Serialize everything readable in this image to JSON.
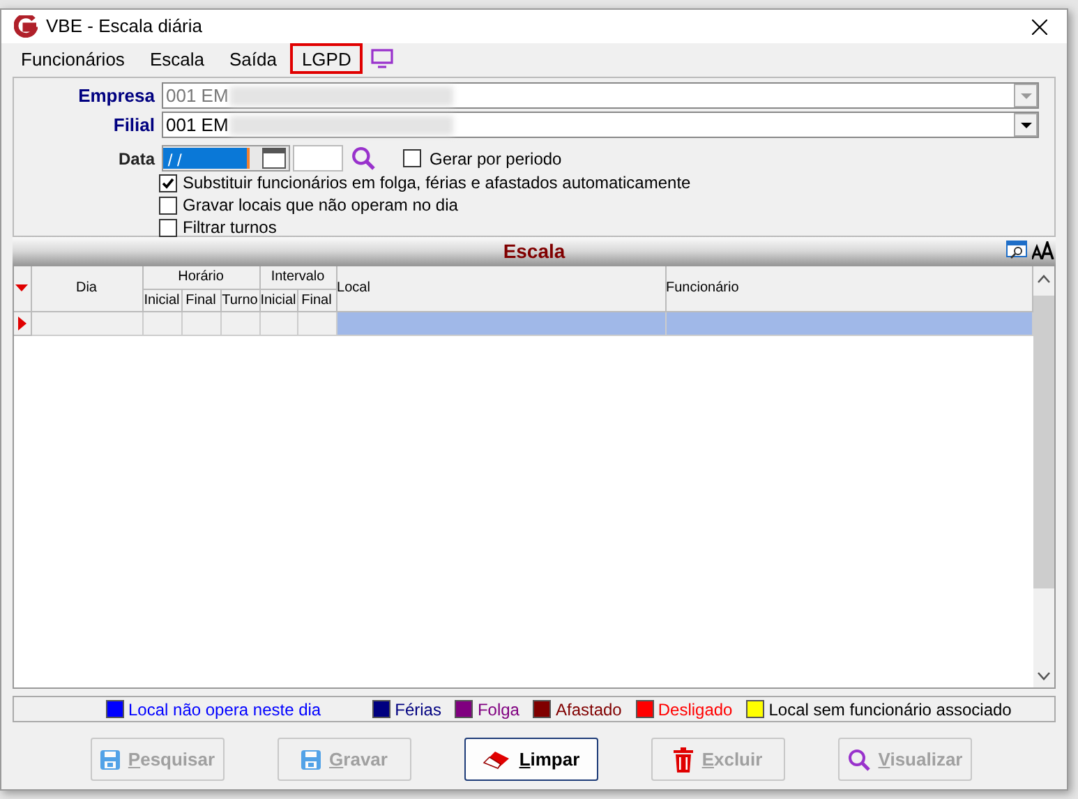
{
  "window": {
    "title": "VBE - Escala diária"
  },
  "menu": [
    {
      "label": "Funcionários",
      "highlighted": false
    },
    {
      "label": "Escala",
      "highlighted": false
    },
    {
      "label": "Saída",
      "highlighted": false
    },
    {
      "label": "LGPD",
      "highlighted": true
    }
  ],
  "form": {
    "empresa": {
      "label": "Empresa",
      "value": "001 EM",
      "disabled": true
    },
    "filial": {
      "label": "Filial",
      "value": "001 EM",
      "disabled": false
    },
    "data": {
      "label": "Data",
      "value": " / /"
    },
    "gerar_periodo": {
      "label": "Gerar por periodo",
      "checked": false
    },
    "options": [
      {
        "label": "Substituir funcionários em folga, férias e afastados automaticamente",
        "checked": true
      },
      {
        "label": "Gravar locais que não operam no dia",
        "checked": false
      },
      {
        "label": "Filtrar turnos",
        "checked": false
      }
    ]
  },
  "grid": {
    "title": "Escala",
    "groups": [
      {
        "label": "Horário",
        "columns": [
          "Inicial",
          "Final",
          "Turno"
        ]
      },
      {
        "label": "Intervalo",
        "columns": [
          "Inicial",
          "Final"
        ]
      }
    ],
    "dia": "Dia",
    "local": "Local",
    "funcionario": "Funcionário",
    "rows": [
      {
        "selected": true
      }
    ]
  },
  "legend": [
    {
      "label": "Local não opera neste dia",
      "color": "#0000ff",
      "kind": "tinted"
    },
    {
      "label": "Férias",
      "color": "#000080",
      "kind": "tinted"
    },
    {
      "label": "Folga",
      "color": "#800080",
      "kind": "tinted"
    },
    {
      "label": "Afastado",
      "color": "#800000",
      "kind": "tinted"
    },
    {
      "label": "Desligado",
      "color": "#ff0000",
      "kind": "tinted"
    },
    {
      "label": "Local sem funcionário associado",
      "color": "#ffff00",
      "kind": "plain"
    }
  ],
  "buttons": [
    {
      "label": "Pesquisar",
      "kind": "save",
      "disabled": true
    },
    {
      "label": "Gravar",
      "kind": "save",
      "disabled": true
    },
    {
      "label": "Limpar",
      "kind": "clear",
      "disabled": false
    },
    {
      "label": "Excluir",
      "kind": "delete",
      "disabled": true
    },
    {
      "label": "Visualizar",
      "kind": "view",
      "disabled": true
    }
  ]
}
